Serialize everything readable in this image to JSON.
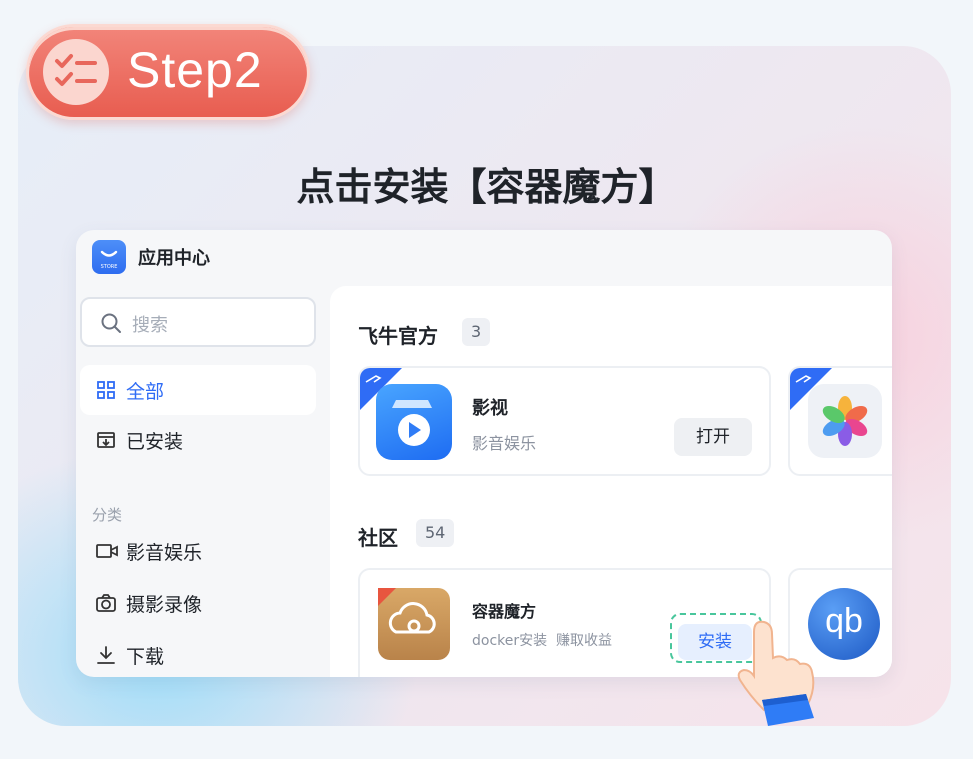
{
  "step": {
    "label": "Step2"
  },
  "instruction": "点击安装【容器魔方】",
  "window": {
    "title": "应用中心",
    "logo_text": "STORE"
  },
  "sidebar": {
    "search_placeholder": "搜索",
    "items": [
      {
        "label": "全部",
        "icon": "grid-icon",
        "active": true
      },
      {
        "label": "已安装",
        "icon": "installed-box-icon",
        "active": false
      }
    ],
    "category_label": "分类",
    "categories": [
      {
        "label": "影音娱乐",
        "icon": "video-camera-icon"
      },
      {
        "label": "摄影录像",
        "icon": "camera-icon"
      },
      {
        "label": "下载",
        "icon": "download-icon"
      }
    ]
  },
  "main": {
    "groups": [
      {
        "title": "飞牛官方",
        "count": "3",
        "apps": [
          {
            "name": "影视",
            "desc": "影音娱乐",
            "action": "打开",
            "icon": "video-app-icon"
          },
          {
            "name": "",
            "desc": "",
            "action": "",
            "icon": "photos-app-icon"
          }
        ]
      },
      {
        "title": "社区",
        "count": "54",
        "apps": [
          {
            "name": "容器魔方",
            "desc": "docker安装  赚取收益",
            "action": "安装",
            "icon": "container-cube-app-icon"
          },
          {
            "name": "",
            "desc": "",
            "action": "",
            "icon": "qbittorrent-app-icon",
            "icon_text": "qb"
          }
        ]
      }
    ]
  },
  "colors": {
    "accent": "#2f6cf5",
    "step_badge": "#e85d50",
    "highlight": "#49c69c"
  }
}
